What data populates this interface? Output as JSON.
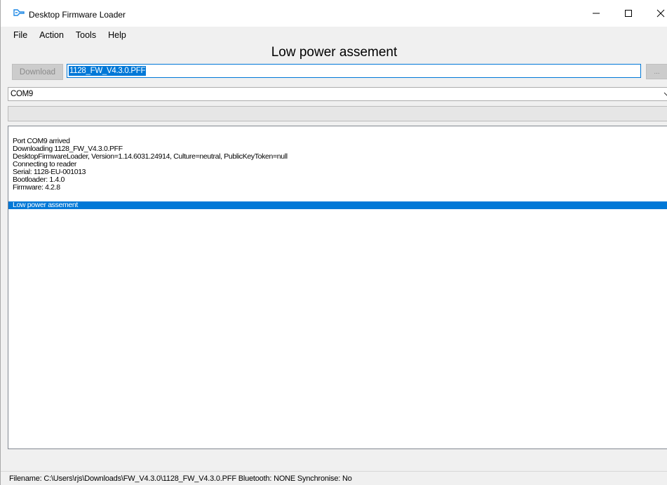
{
  "window": {
    "title": "Desktop Firmware Loader",
    "icon": "firmware-loader-app-icon",
    "accent_color": "#0078d7"
  },
  "menu": {
    "items": [
      "File",
      "Action",
      "Tools",
      "Help"
    ]
  },
  "header": {
    "status_title": "Low power assement"
  },
  "toolbar": {
    "download_label": "Download",
    "file_value": "1128_FW_V4.3.0.PFF",
    "browse_label": "...",
    "port_value": "COM9"
  },
  "log": {
    "lines": [
      "Port COM9 arrived",
      "Downloading 1128_FW_V4.3.0.PFF",
      "DesktopFirmwareLoader, Version=1.14.6031.24914, Culture=neutral, PublicKeyToken=null",
      "Connecting to reader",
      "Serial: 1128-EU-001013",
      "Bootloader: 1.4.0",
      "Firmware: 4.2.8",
      "Low power assement"
    ],
    "selected_index": 7
  },
  "statusbar": {
    "text": "Filename: C:\\Users\\rjs\\Downloads\\FW_V4.3.0\\1128_FW_V4.3.0.PFF  Bluetooth: NONE  Synchronise: No"
  }
}
